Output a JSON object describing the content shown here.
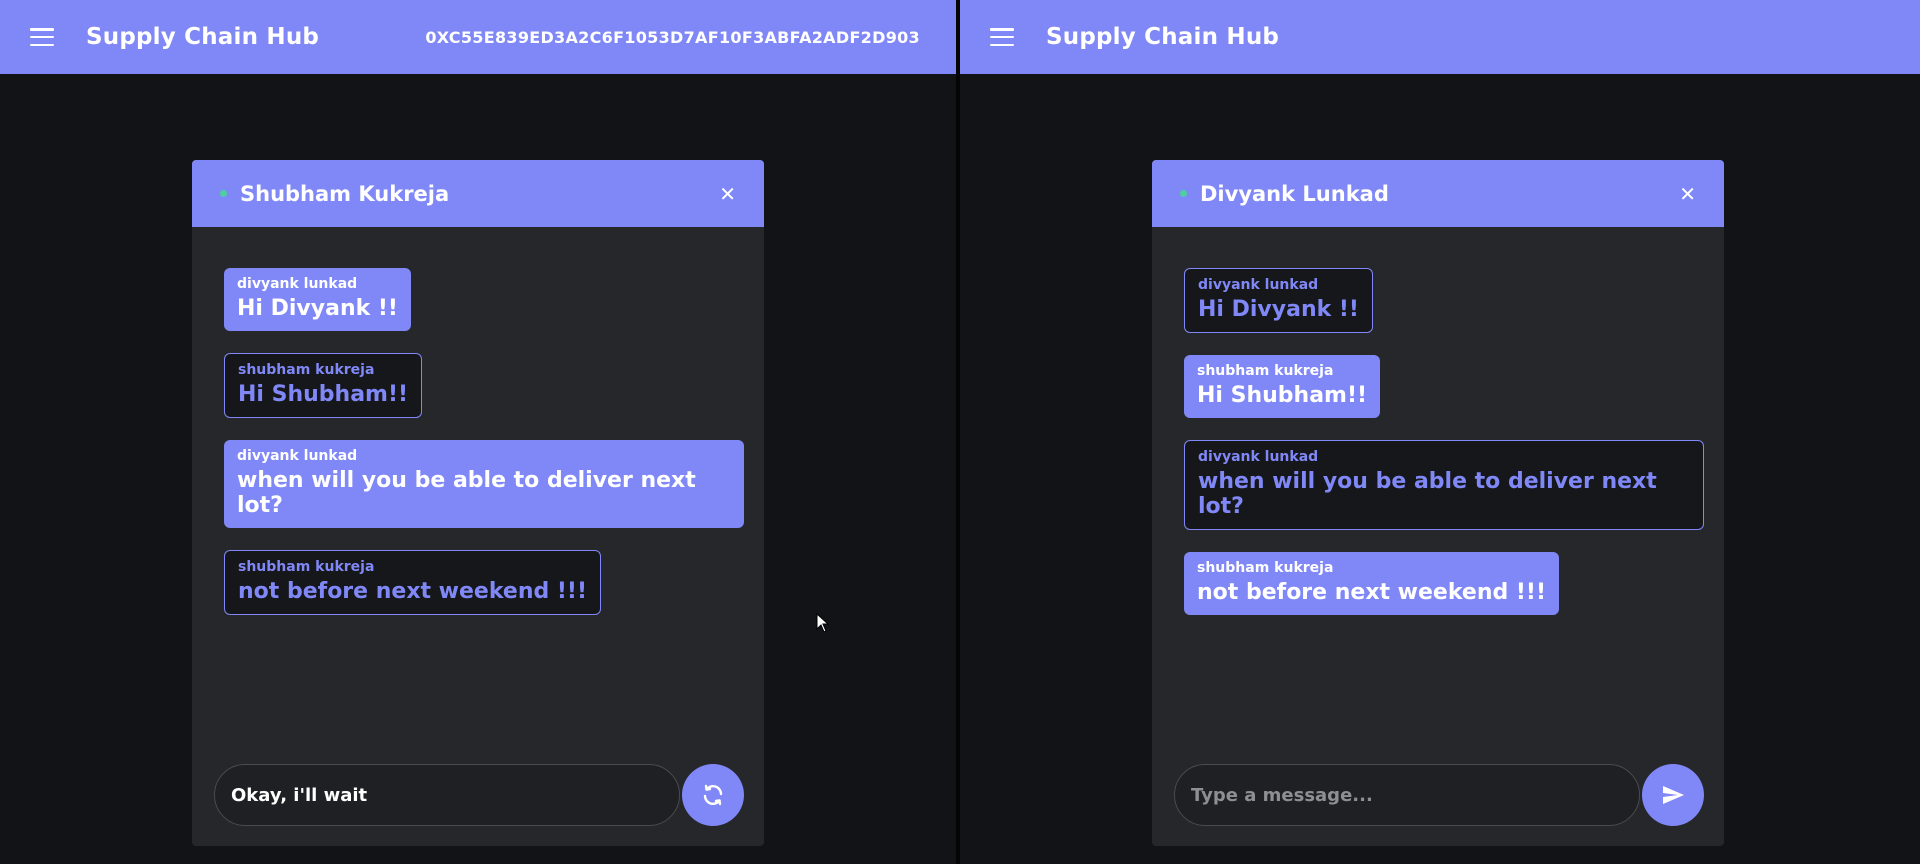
{
  "colors": {
    "accent": "#8088f7",
    "background": "#121316",
    "panel": "#26272b",
    "online": "#4cd0a0"
  },
  "left": {
    "app_title": "Supply Chain Hub",
    "wallet_address": "0XC55E839ED3A2C6F1053D7AF10F3ABFA2ADF2D903",
    "chat": {
      "contact_name": "Shubham Kukreja",
      "messages": [
        {
          "sender": "divyank lunkad",
          "text": "Hi Divyank !!",
          "style": "filled"
        },
        {
          "sender": "shubham kukreja",
          "text": "Hi Shubham!!",
          "style": "outlined"
        },
        {
          "sender": "divyank lunkad",
          "text": "when will you be able to deliver next lot?",
          "style": "filled"
        },
        {
          "sender": "shubham kukreja",
          "text": "not before next weekend !!!",
          "style": "outlined"
        }
      ],
      "input_value": "Okay, i'll wait",
      "action_icon": "refresh-icon"
    }
  },
  "right": {
    "app_title": "Supply Chain Hub",
    "chat": {
      "contact_name": "Divyank Lunkad",
      "messages": [
        {
          "sender": "divyank lunkad",
          "text": "Hi Divyank !!",
          "style": "outlined"
        },
        {
          "sender": "shubham kukreja",
          "text": "Hi Shubham!!",
          "style": "filled"
        },
        {
          "sender": "divyank lunkad",
          "text": "when will you be able to deliver next lot?",
          "style": "outlined"
        },
        {
          "sender": "shubham kukreja",
          "text": "not before next weekend !!!",
          "style": "filled"
        }
      ],
      "input_placeholder": "Type a message...",
      "action_icon": "send-icon"
    }
  }
}
